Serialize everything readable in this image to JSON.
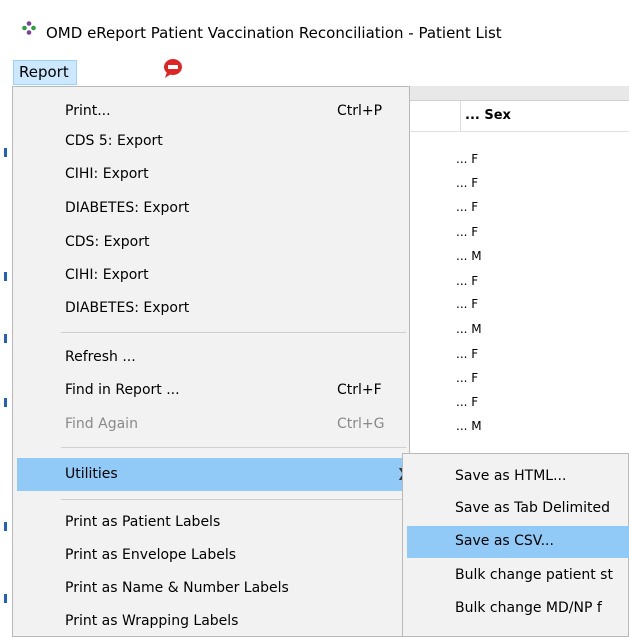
{
  "window": {
    "title": "OMD eReport Patient Vaccination Reconciliation - Patient List"
  },
  "menubar": {
    "report_label": "Report"
  },
  "colors": {
    "menu_highlight": "#91c9f7",
    "menubar_selected": "#cce8ff",
    "close_red": "#e02424"
  },
  "icons": {
    "app": "app-logo-icon",
    "close": "close-icon",
    "submenu_arrow": "chevron-right-icon"
  },
  "report_menu": {
    "print": {
      "label": "Print...",
      "shortcut": "Ctrl+P"
    },
    "cds5_export": "CDS 5: Export",
    "cihi_export_1": "CIHI: Export",
    "diabetes_export_1": "DIABETES: Export",
    "cds_export": "CDS: Export",
    "cihi_export_2": "CIHI: Export",
    "diabetes_export_2": "DIABETES: Export",
    "refresh": "Refresh ...",
    "find": {
      "label": "Find in Report ...",
      "shortcut": "Ctrl+F"
    },
    "find_again": {
      "label": "Find Again",
      "shortcut": "Ctrl+G"
    },
    "utilities": "Utilities",
    "print_patient_labels": "Print as Patient Labels",
    "print_envelope_labels": "Print as Envelope Labels",
    "print_name_number_labels": "Print as Name & Number Labels",
    "print_wrapping_labels": "Print as Wrapping Labels"
  },
  "utilities_menu": {
    "save_html": "Save as HTML...",
    "save_tab": "Save as Tab Delimited",
    "save_csv": "Save as CSV...",
    "bulk_status": "Bulk change patient st",
    "bulk_mdnp": "Bulk change MD/NP f"
  },
  "grid": {
    "header_prefix": "...",
    "header_sex": "Sex",
    "rows": [
      "... F",
      "... F",
      "... F",
      "... F",
      "... M",
      "... F",
      "... F",
      "... M",
      "... F",
      "... F",
      "... F",
      "... M"
    ]
  }
}
